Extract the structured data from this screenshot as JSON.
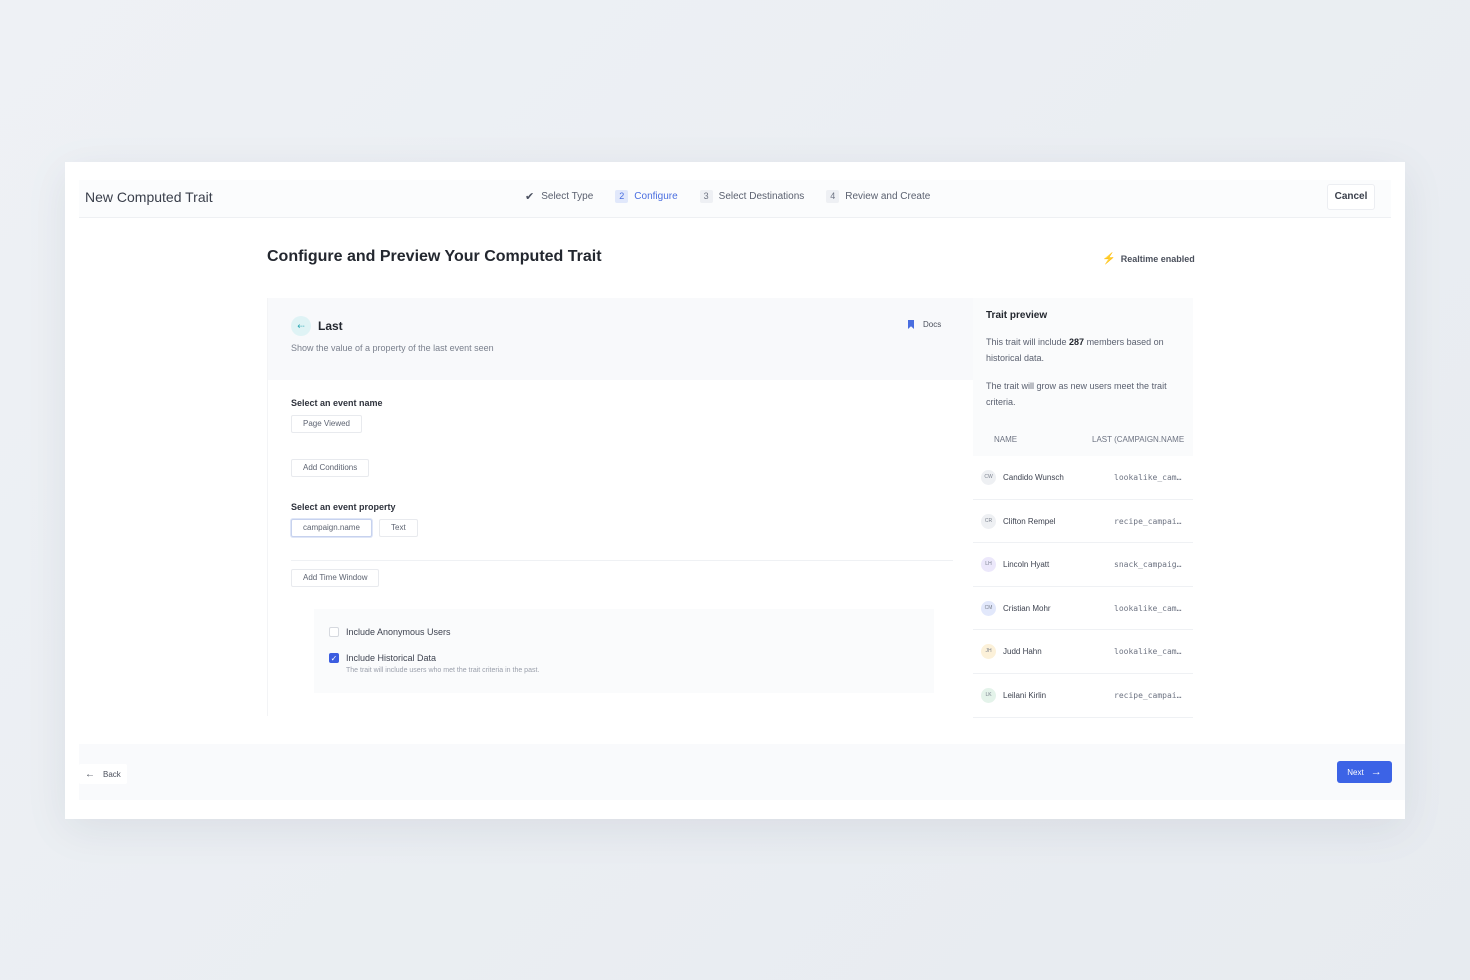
{
  "header": {
    "title": "New Computed Trait",
    "steps": [
      {
        "num": "",
        "label": "Select Type"
      },
      {
        "num": "2",
        "label": "Configure"
      },
      {
        "num": "3",
        "label": "Select Destinations"
      },
      {
        "num": "4",
        "label": "Review and Create"
      }
    ],
    "cancel": "Cancel"
  },
  "page": {
    "title": "Configure and Preview Your Computed Trait",
    "realtime": "Realtime enabled"
  },
  "config": {
    "type_name": "Last",
    "type_icon": "arrow-icon",
    "type_desc": "Show the value of a property of the last event seen",
    "docs": "Docs",
    "event_label": "Select an event name",
    "event_value": "Page Viewed",
    "add_conditions": "Add Conditions",
    "property_label": "Select an event property",
    "property_value": "campaign.name",
    "property_type": "Text",
    "add_time_window": "Add Time Window",
    "opt_anonymous": "Include Anonymous Users",
    "opt_historical": "Include Historical Data",
    "opt_historical_help": "The trait will include users who met the trait criteria in the past."
  },
  "preview": {
    "title": "Trait preview",
    "text1_a": "This trait will include ",
    "text1_count": "287",
    "text1_b": " members based on historical data.",
    "text2": "The trait will grow as new users meet the trait criteria.",
    "col_name": "NAME",
    "col_last": "LAST (CAMPAIGN.NAME)",
    "rows": [
      {
        "initials": "CW",
        "name": "Candido Wunsch",
        "value": "lookalike_cam…",
        "color": "#eef0f3"
      },
      {
        "initials": "CR",
        "name": "Clifton Rempel",
        "value": "recipe_campai…",
        "color": "#eef0f3"
      },
      {
        "initials": "LH",
        "name": "Lincoln Hyatt",
        "value": "snack_campaig…",
        "color": "#ece8fb"
      },
      {
        "initials": "CM",
        "name": "Cristian Mohr",
        "value": "lookalike_cam…",
        "color": "#e2e8fb"
      },
      {
        "initials": "JH",
        "name": "Judd Hahn",
        "value": "lookalike_cam…",
        "color": "#fcf1d9"
      },
      {
        "initials": "LK",
        "name": "Leilani Kirlin",
        "value": "recipe_campai…",
        "color": "#e4f3ea"
      }
    ]
  },
  "footer": {
    "back": "Back",
    "next": "Next"
  }
}
